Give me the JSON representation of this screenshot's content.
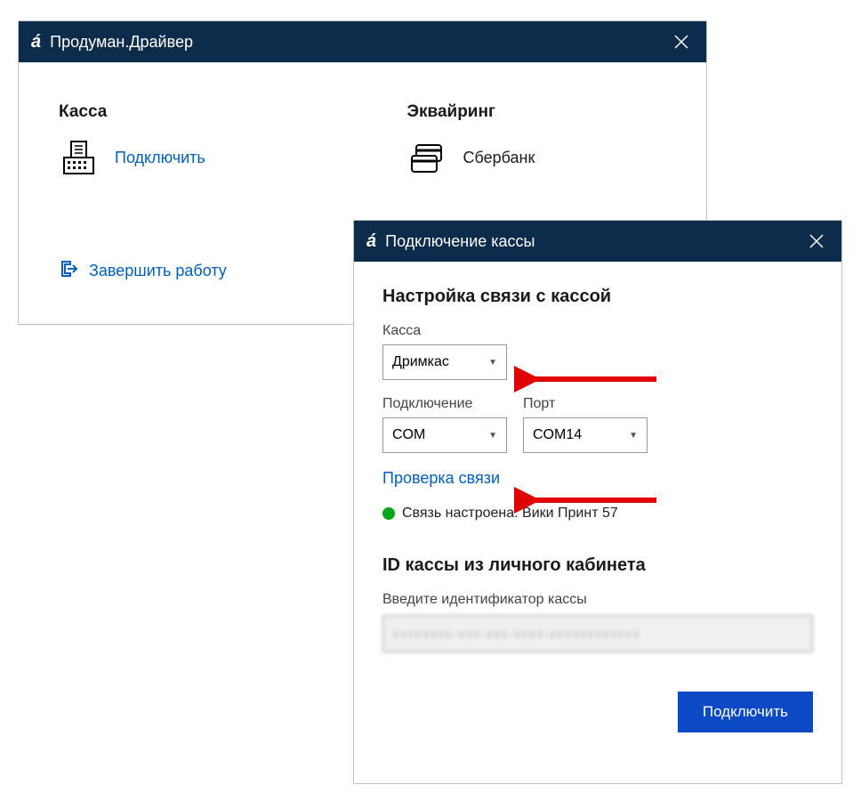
{
  "window1": {
    "title": "Продуман.Драйвер",
    "kassa_heading": "Касса",
    "kassa_link": "Подключить",
    "acq_heading": "Эквайринг",
    "acq_value": "Сбербанк",
    "quit_label": "Завершить работу"
  },
  "window2": {
    "title": "Подключение кассы",
    "section_heading": "Настройка связи с кассой",
    "kassa_label": "Касса",
    "kassa_value": "Дримкас",
    "conn_label": "Подключение",
    "conn_value": "COM",
    "port_label": "Порт",
    "port_value": "COM14",
    "check_link": "Проверка связи",
    "status_text": "Связь настроена: Вики Принт 57",
    "id_heading": "ID кассы из личного кабинета",
    "id_sublabel": "Введите идентификатор кассы",
    "id_masked": "xxxxxxxx-xxx-xxx-xxxx-xxxxxxxxxxxx",
    "connect_button": "Подключить"
  }
}
